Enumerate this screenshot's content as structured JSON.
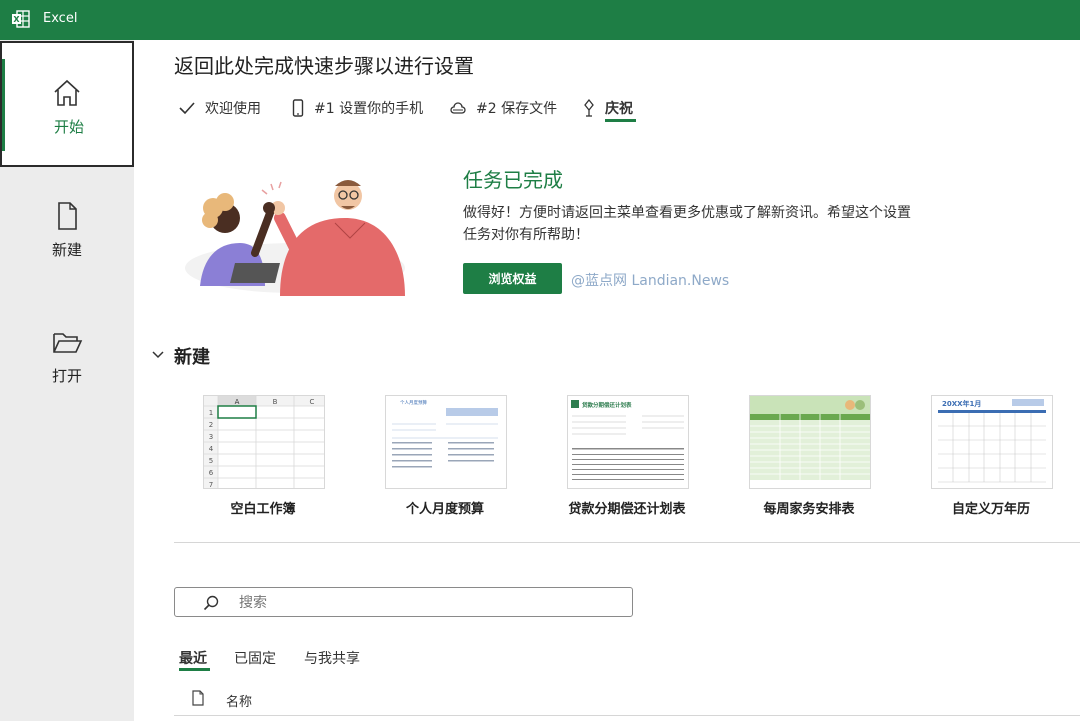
{
  "app": {
    "title": "Excel"
  },
  "sidebar": {
    "items": [
      {
        "label": "开始"
      },
      {
        "label": "新建"
      },
      {
        "label": "打开"
      }
    ]
  },
  "setup": {
    "title": "返回此处完成快速步骤以进行设置",
    "steps": [
      {
        "label": "欢迎使用"
      },
      {
        "label": "#1 设置你的手机"
      },
      {
        "label": "#2 保存文件"
      },
      {
        "label": "庆祝"
      }
    ]
  },
  "completion": {
    "title": "任务已完成",
    "description_line1": "做得好！方便时请返回主菜单查看更多优惠或了解新资讯。希望这个设置",
    "description_line2": "任务对你有所帮助！",
    "button_label": "浏览权益",
    "watermark": "@蓝点网 Landian.News"
  },
  "new_section": {
    "title": "新建",
    "templates": [
      {
        "label": "空白工作簿"
      },
      {
        "label": "个人月度预算"
      },
      {
        "label": "贷款分期偿还计划表"
      },
      {
        "label": "每周家务安排表"
      },
      {
        "label": "自定义万年历"
      }
    ],
    "blank": {
      "cols": [
        "A",
        "B",
        "C"
      ],
      "rows": [
        "1",
        "2",
        "3",
        "4",
        "5",
        "6",
        "7"
      ]
    },
    "budget_heading": "个人月度预算",
    "loan_heading": "贷款分期偿还计划表",
    "calendar_heading": "20XX年1月"
  },
  "search": {
    "placeholder": "搜索"
  },
  "file_tabs": [
    {
      "label": "最近"
    },
    {
      "label": "已固定"
    },
    {
      "label": "与我共享"
    }
  ],
  "file_list": {
    "name_header": "名称"
  },
  "colors": {
    "accent": "#1e7e45",
    "sidebar_bg": "#ececec"
  }
}
